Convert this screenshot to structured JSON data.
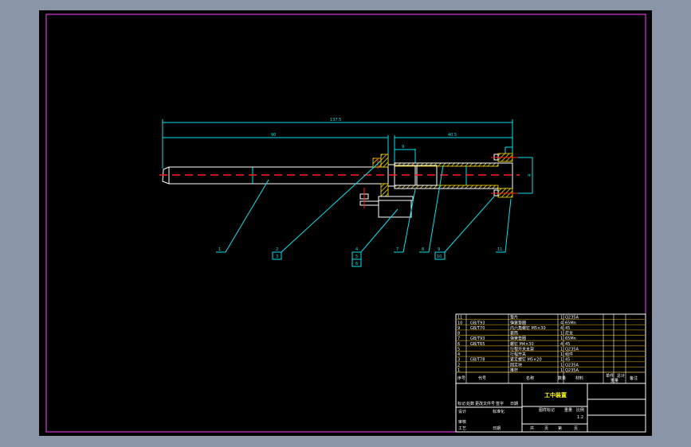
{
  "drawing": {
    "dimensions": {
      "overall": "137.5",
      "shaft": "90",
      "tube": "40.5",
      "slot": "9",
      "end": "4"
    },
    "balloons": [
      "1",
      "2",
      "3",
      "4",
      "5",
      "6",
      "7",
      "8",
      "9",
      "10",
      "11"
    ]
  },
  "title_block": {
    "title": "工中装置",
    "parts": [
      {
        "no": "11",
        "code": "",
        "name": "垫片",
        "qty": "1",
        "mat": "Q235A"
      },
      {
        "no": "10",
        "code": "GB/T93",
        "name": "弹簧垫圈",
        "qty": "4",
        "mat": "65Mn"
      },
      {
        "no": "9",
        "code": "GB/T70",
        "name": "内六角螺钉 M5×30",
        "qty": "4",
        "mat": "45"
      },
      {
        "no": "8",
        "code": "",
        "name": "套筒",
        "qty": "1",
        "mat": "尼龙"
      },
      {
        "no": "7",
        "code": "GB/T93",
        "name": "弹簧垫圈",
        "qty": "1",
        "mat": "65Mn"
      },
      {
        "no": "6",
        "code": "GB/T65",
        "name": "螺钉 M4×30",
        "qty": "4",
        "mat": "45"
      },
      {
        "no": "5",
        "code": "",
        "name": "行程开关支架",
        "qty": "1",
        "mat": "Q235A"
      },
      {
        "no": "4",
        "code": "",
        "name": "行程开关",
        "qty": "1",
        "mat": "组件"
      },
      {
        "no": "3",
        "code": "GB/T78",
        "name": "紧定螺钉 M5×20",
        "qty": "1",
        "mat": "45"
      },
      {
        "no": "2",
        "code": "",
        "name": "固定块",
        "qty": "1",
        "mat": "Q235A"
      },
      {
        "no": "1",
        "code": "",
        "name": "推杆",
        "qty": "1",
        "mat": "Q235A"
      }
    ],
    "headers": [
      "序号",
      "代号",
      "名称",
      "数量",
      "材料",
      "单件",
      "总计",
      "重量",
      "备注"
    ],
    "lower": {
      "mark": "标记",
      "count": "处数",
      "file": "更改文件号",
      "sign": "签字",
      "date": "日期",
      "design": "设计",
      "std": "标准化",
      "check": "审核",
      "process": "工艺",
      "date2": "日期",
      "pattern": "图样标记",
      "weight": "重量",
      "scale": "比例",
      "scale_val": "1:2",
      "total": "共",
      "page": "页",
      "nth": "第",
      "page2": "页"
    }
  }
}
